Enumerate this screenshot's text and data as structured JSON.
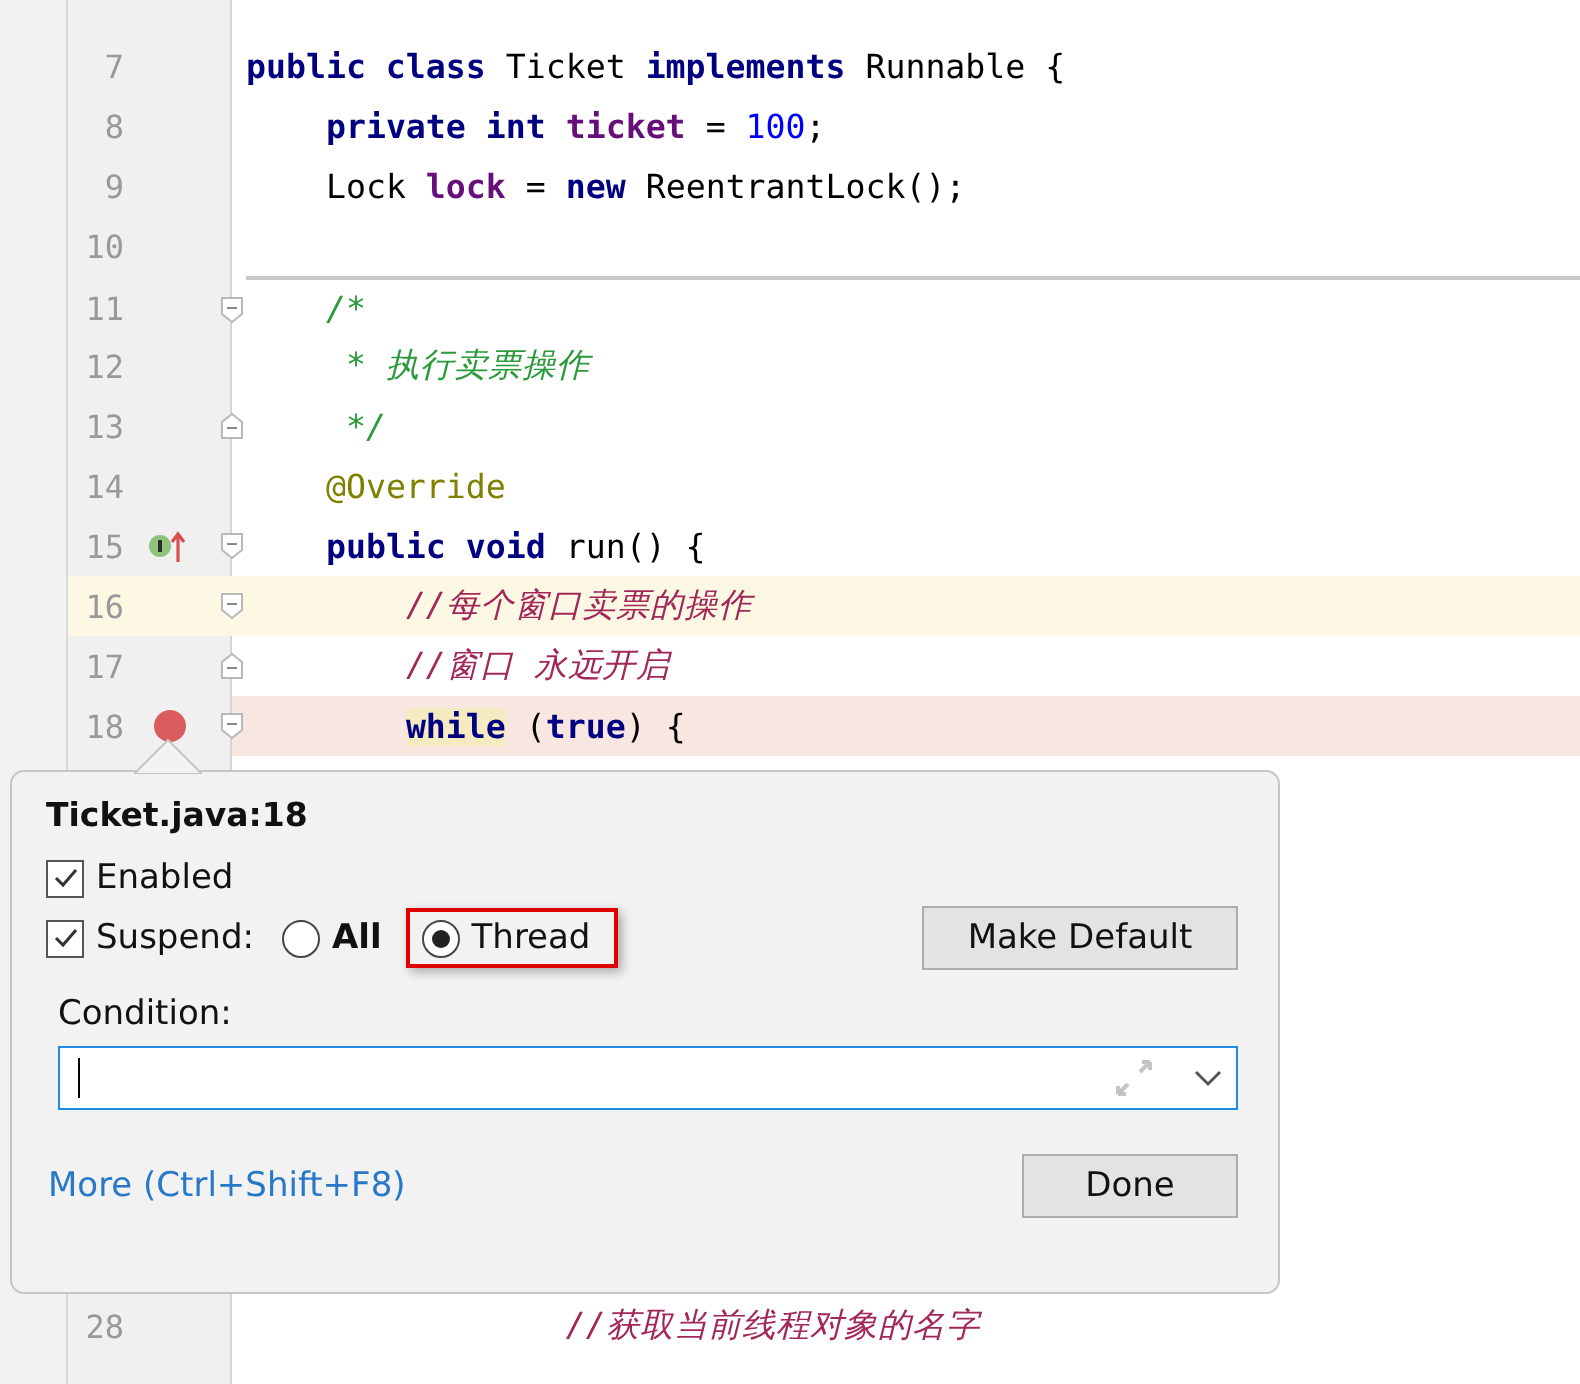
{
  "editor": {
    "lines": [
      {
        "number": "7",
        "tokens": [
          {
            "text": "public class ",
            "kind": "keyword"
          },
          {
            "text": "Ticket ",
            "kind": "plain"
          },
          {
            "text": "implements",
            "kind": "keyword"
          },
          {
            "text": " Runnable {",
            "kind": "plain"
          }
        ]
      },
      {
        "number": "8",
        "tokens": [
          {
            "text": "    private int ",
            "kind": "keyword"
          },
          {
            "text": "ticket",
            "kind": "field"
          },
          {
            "text": " = ",
            "kind": "plain"
          },
          {
            "text": "100",
            "kind": "number"
          },
          {
            "text": ";",
            "kind": "plain"
          }
        ]
      },
      {
        "number": "9",
        "tokens": [
          {
            "text": "    Lock ",
            "kind": "plain"
          },
          {
            "text": "lock",
            "kind": "field"
          },
          {
            "text": " = ",
            "kind": "plain"
          },
          {
            "text": "new",
            "kind": "keyword"
          },
          {
            "text": " ReentrantLock();",
            "kind": "plain"
          }
        ]
      },
      {
        "number": "10"
      },
      {
        "number": "11",
        "separator_above": true,
        "fold_start": true,
        "tokens": [
          {
            "text": "    /*",
            "kind": "doc"
          }
        ]
      },
      {
        "number": "12",
        "tokens": [
          {
            "text": "     * 执行卖票操作",
            "kind": "doc"
          }
        ]
      },
      {
        "number": "13",
        "fold_end": true,
        "tokens": [
          {
            "text": "     */",
            "kind": "doc"
          }
        ]
      },
      {
        "number": "14",
        "tokens": [
          {
            "text": "    @Override",
            "kind": "annotation"
          }
        ]
      },
      {
        "number": "15",
        "fold_start": true,
        "implements_marker": true,
        "tokens": [
          {
            "text": "    public void ",
            "kind": "keyword"
          },
          {
            "text": "run() {",
            "kind": "plain"
          }
        ]
      },
      {
        "number": "16",
        "fold_start": true,
        "current_line": true,
        "tokens": [
          {
            "text": "        //每个窗口卖票的操作",
            "kind": "comment"
          }
        ]
      },
      {
        "number": "17",
        "fold_end": true,
        "tokens": [
          {
            "text": "        //窗口 永远开启",
            "kind": "comment"
          }
        ]
      },
      {
        "number": "18",
        "fold_start": true,
        "breakpoint": true,
        "tokens": [
          {
            "text": "        while",
            "kind": "keyword",
            "highlight": true
          },
          {
            "text": " (",
            "kind": "plain"
          },
          {
            "text": "true",
            "kind": "keyword"
          },
          {
            "text": ") {",
            "kind": "plain"
          }
        ]
      },
      {
        "number": "28",
        "tokens": [
          {
            "text": "                //获取当前线程对象的名字",
            "kind": "comment"
          }
        ]
      }
    ]
  },
  "popup": {
    "title": "Ticket.java:18",
    "enabled": {
      "label": "Enabled",
      "checked": true
    },
    "suspend": {
      "label": "Suspend:",
      "checked": true
    },
    "suspend_options": [
      {
        "label": "All",
        "selected": false,
        "framed": false
      },
      {
        "label": "Thread",
        "selected": true,
        "framed": true
      }
    ],
    "make_default": "Make Default",
    "condition": {
      "label": "Condition:"
    },
    "more_link": "More (Ctrl+Shift+F8)",
    "done": "Done"
  }
}
